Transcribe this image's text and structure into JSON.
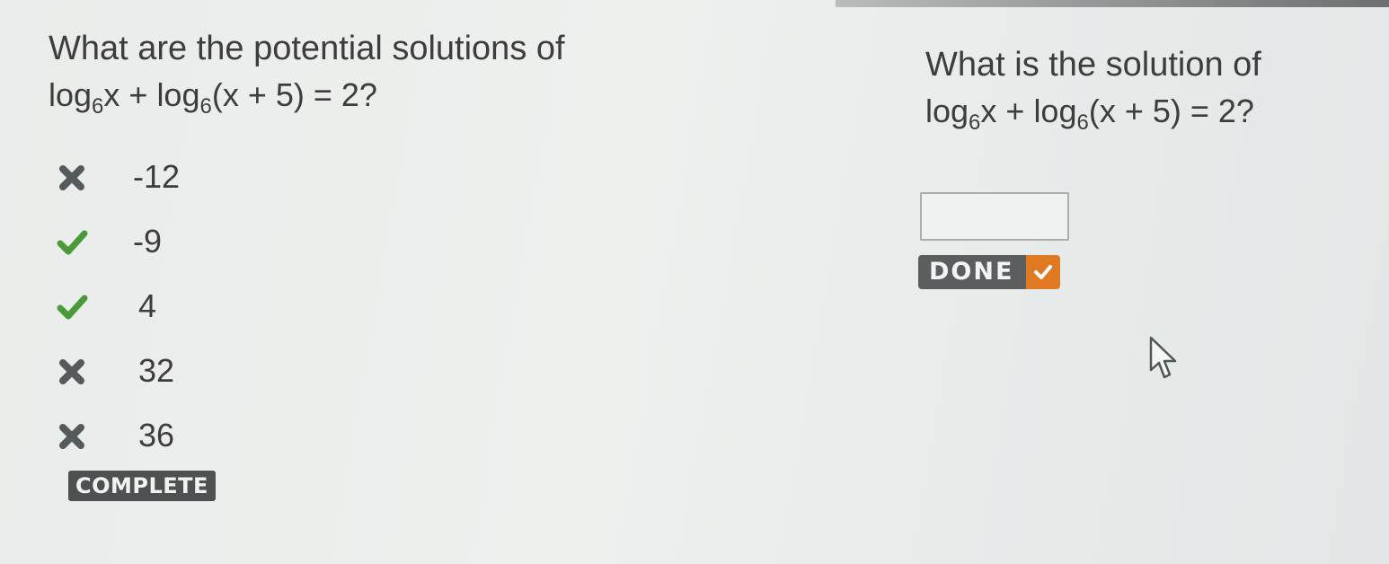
{
  "left_question": {
    "prompt": "What are the potential solutions of",
    "equation": {
      "log1": "log",
      "base1": "6",
      "term1": "x",
      "plus": " + ",
      "log2": "log",
      "base2": "6",
      "term2": "(x + 5) = 2?"
    },
    "answers": [
      {
        "value": "-12",
        "status": "incorrect",
        "icon": "x-mark-icon"
      },
      {
        "value": "-9",
        "status": "correct",
        "icon": "check-mark-icon"
      },
      {
        "value": "4",
        "status": "correct",
        "icon": "check-mark-icon"
      },
      {
        "value": "32",
        "status": "incorrect",
        "icon": "x-mark-icon"
      },
      {
        "value": "36",
        "status": "incorrect",
        "icon": "x-mark-icon"
      }
    ],
    "complete_label": "COMPLETE"
  },
  "right_question": {
    "prompt": "What is the solution of",
    "equation": {
      "log1": "log",
      "base1": "6",
      "term1": "x",
      "plus": " + ",
      "log2": "log",
      "base2": "6",
      "term2": "(x + 5) = 2?"
    },
    "input_value": "",
    "done_label": "DONE"
  },
  "colors": {
    "correct": "#4a9a3a",
    "incorrect": "#555a5c",
    "done_accent": "#e07a22",
    "badge_bg": "#4d5152"
  }
}
